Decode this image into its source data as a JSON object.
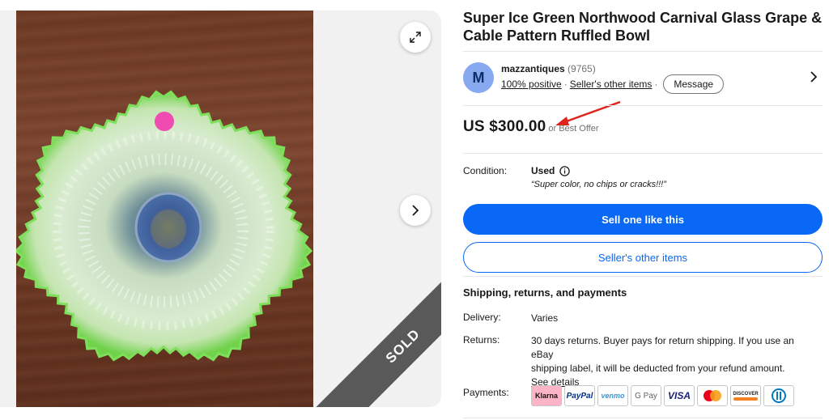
{
  "gallery": {
    "sold_label": "SOLD",
    "expand_icon": "expand-icon",
    "next_icon": "chevron-right-icon"
  },
  "listing": {
    "title": "Super Ice Green Northwood Carnival Glass Grape & Cable Pattern Ruffled Bowl"
  },
  "seller": {
    "avatar_letter": "M",
    "name": "mazzantiques",
    "feedback_count": "(9765)",
    "positive": "100% positive",
    "other_items_link": "Seller's other items",
    "message_button": "Message"
  },
  "price": {
    "amount": "US $300.00",
    "best_offer": "or Best Offer"
  },
  "condition": {
    "label": "Condition:",
    "value": "Used",
    "note": "“Super color, no chips or cracks!!!”"
  },
  "actions": {
    "primary": "Sell one like this",
    "secondary": "Seller's other items"
  },
  "shipping": {
    "title": "Shipping, returns, and payments",
    "delivery_label": "Delivery:",
    "delivery_value": "Varies",
    "returns_label": "Returns:",
    "returns_line1": "30 days returns. Buyer pays for return shipping. If you use an eBay",
    "returns_line2": "shipping label, it will be deducted from your refund amount.",
    "see_details": "See details",
    "payments_label": "Payments:"
  },
  "payment_methods": {
    "klarna": "Klarna",
    "paypal": "PayPal",
    "venmo": "venmo",
    "gpay": "G Pay",
    "visa": "VISA",
    "discover": "DISCOVER"
  },
  "colors": {
    "accent_blue": "#0968f6",
    "annotation_red": "#e0241b",
    "sold_ribbon": "#595959"
  }
}
